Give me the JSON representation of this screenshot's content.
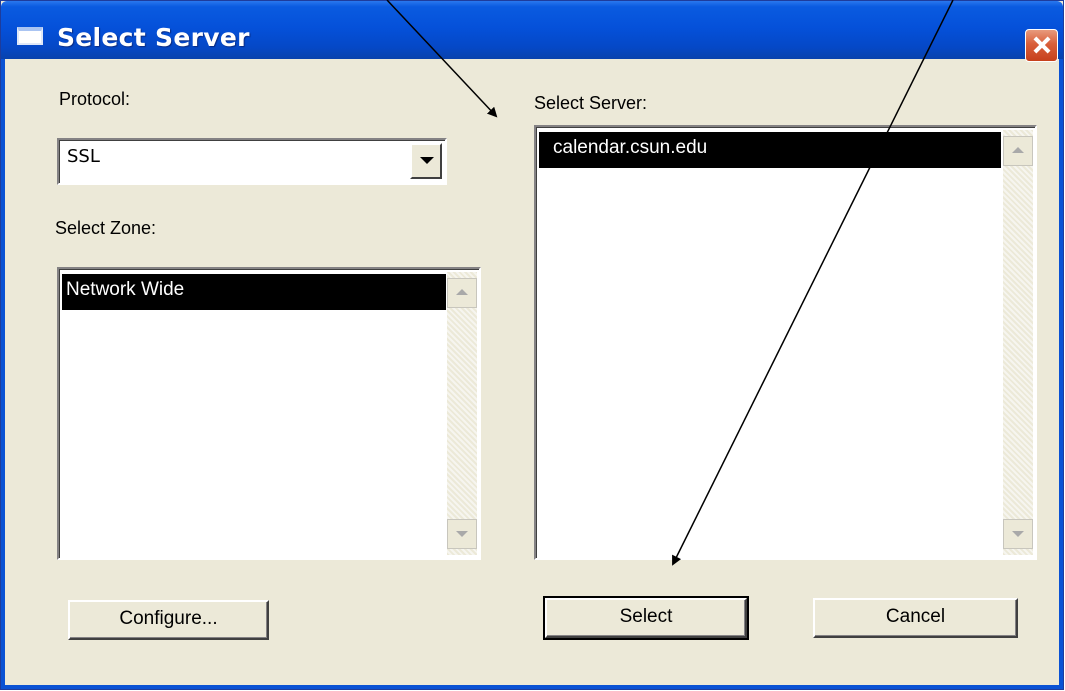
{
  "window": {
    "title": "Select Server"
  },
  "protocol": {
    "label": "Protocol:",
    "value": "SSL"
  },
  "zone": {
    "label": "Select Zone:",
    "items": [
      "Network Wide"
    ]
  },
  "server": {
    "label": "Select Server:",
    "items": [
      "calendar.csun.edu"
    ]
  },
  "buttons": {
    "configure": "Configure...",
    "select": "Select",
    "cancel": "Cancel"
  },
  "colors": {
    "titlebar": "#0551da",
    "dialog_bg": "#ece9d8",
    "selection_bg": "#000000",
    "close_button": "#d95f3a"
  },
  "icons": {
    "window": "window-icon",
    "close": "close-icon",
    "dropdown": "chevron-down-icon",
    "scroll_up": "scroll-up-icon",
    "scroll_down": "scroll-down-icon"
  }
}
